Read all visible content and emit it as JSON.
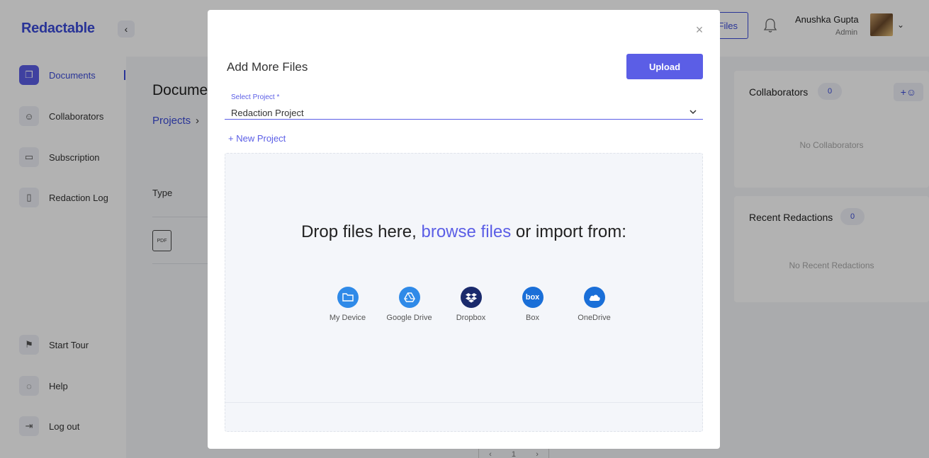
{
  "app": {
    "logo": "Redactable"
  },
  "header": {
    "files_btn": "Files",
    "user_name": "Anushka Gupta",
    "user_role": "Admin"
  },
  "sidebar": {
    "items": [
      {
        "label": "Documents",
        "icon": "documents-icon",
        "active": true
      },
      {
        "label": "Collaborators",
        "icon": "user-icon"
      },
      {
        "label": "Subscription",
        "icon": "card-icon"
      },
      {
        "label": "Redaction Log",
        "icon": "book-icon"
      }
    ],
    "bottom_items": [
      {
        "label": "Start Tour",
        "icon": "flag-icon"
      },
      {
        "label": "Help",
        "icon": "chat-icon"
      },
      {
        "label": "Log out",
        "icon": "logout-icon"
      }
    ]
  },
  "main": {
    "title": "Docume",
    "breadcrumb": "Projects",
    "type_header": "Type",
    "pdf_label": "PDF"
  },
  "collaborators": {
    "title": "Collaborators",
    "count": "0",
    "empty": "No Collaborators"
  },
  "recent": {
    "title": "Recent Redactions",
    "count": "0",
    "empty": "No Recent Redactions"
  },
  "pager": {
    "page": "1"
  },
  "modal": {
    "title": "Add More Files",
    "upload_btn": "Upload",
    "select_label": "Select Project *",
    "select_value": "Redaction Project",
    "new_project": "+ New Project",
    "drop_text_before": "Drop files here, ",
    "drop_browse": "browse files",
    "drop_text_after": " or import from:",
    "sources": [
      {
        "label": "My Device",
        "icon": "folder-icon",
        "color": "#2f8ae8"
      },
      {
        "label": "Google Drive",
        "icon": "google-drive-icon",
        "color": "#2f8ae8"
      },
      {
        "label": "Dropbox",
        "icon": "dropbox-icon",
        "color": "#1a2a6c"
      },
      {
        "label": "Box",
        "icon": "box-icon",
        "color": "#1a6fd8",
        "glyph": "box"
      },
      {
        "label": "OneDrive",
        "icon": "onedrive-icon",
        "color": "#1a6fd8"
      }
    ]
  },
  "colors": {
    "accent": "#5b5ee6",
    "brand": "#3b4bd8",
    "overlay": "rgba(0,0,0,0.30)"
  }
}
